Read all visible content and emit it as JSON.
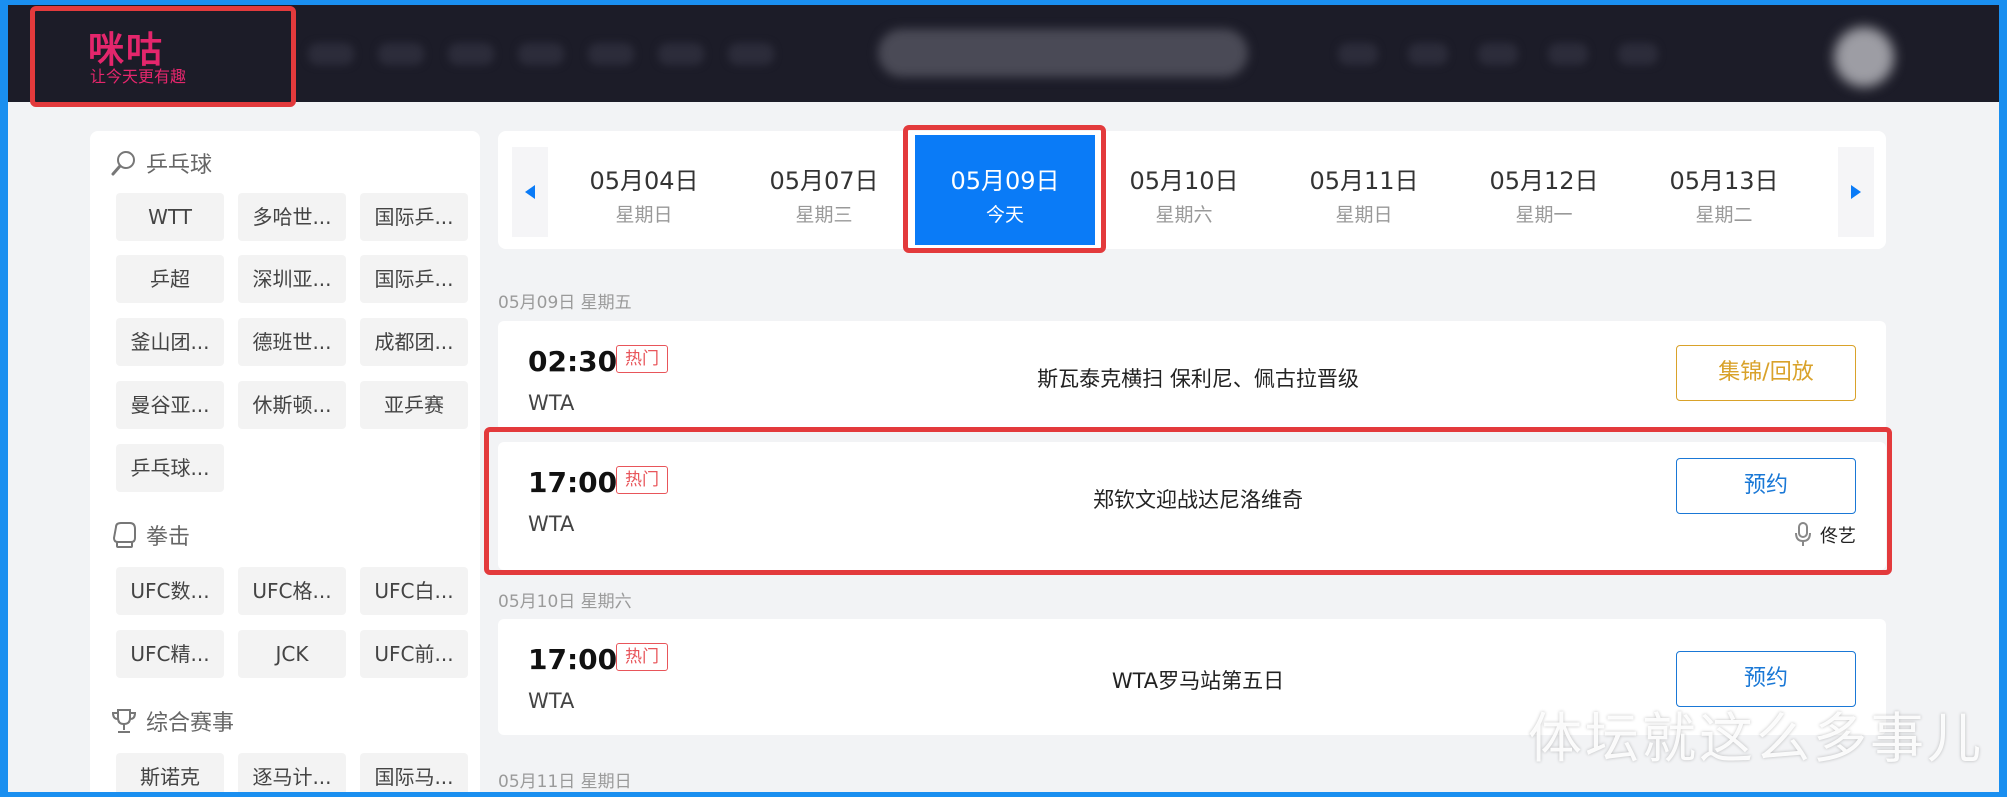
{
  "brand": {
    "name": "咪咕",
    "slogan": "让今天更有趣"
  },
  "sidebar": {
    "categories": [
      {
        "title": "乒乓球",
        "icon": "search-icon",
        "tags": [
          "WTT",
          "多哈世...",
          "国际乒...",
          "乒超",
          "深圳亚...",
          "国际乒...",
          "釜山团...",
          "德班世...",
          "成都团...",
          "曼谷亚...",
          "休斯顿...",
          "亚乒赛",
          "乒乓球..."
        ]
      },
      {
        "title": "拳击",
        "icon": "boxing-glove-icon",
        "tags": [
          "UFC数...",
          "UFC格...",
          "UFC白...",
          "UFC精...",
          "JCK",
          "UFC前..."
        ]
      },
      {
        "title": "综合赛事",
        "icon": "trophy-icon",
        "tags": [
          "斯诺克",
          "逐马计...",
          "国际马..."
        ]
      }
    ]
  },
  "dates": [
    {
      "date": "05月04日",
      "weekday": "星期日"
    },
    {
      "date": "05月07日",
      "weekday": "星期三"
    },
    {
      "date": "05月09日",
      "weekday": "今天",
      "active": true
    },
    {
      "date": "05月10日",
      "weekday": "星期六"
    },
    {
      "date": "05月11日",
      "weekday": "星期日"
    },
    {
      "date": "05月12日",
      "weekday": "星期一"
    },
    {
      "date": "05月13日",
      "weekday": "星期二"
    }
  ],
  "days": [
    {
      "label": "05月09日 星期五"
    },
    {
      "label": "05月10日 星期六"
    },
    {
      "label": "05月11日 星期日"
    }
  ],
  "matches": [
    {
      "time": "02:30",
      "badge": "热门",
      "league": "WTA",
      "title": "斯瓦泰克横扫 保利尼、佩古拉晋级",
      "button": "集锦/回放",
      "commentator": ""
    },
    {
      "time": "17:00",
      "badge": "热门",
      "league": "WTA",
      "title": "郑钦文迎战达尼洛维奇",
      "button": "预约",
      "commentator": "佟艺"
    },
    {
      "time": "17:00",
      "badge": "热门",
      "league": "WTA",
      "title": "WTA罗马站第五日",
      "button": "预约",
      "commentator": ""
    }
  ],
  "watermark": "体坛就这么多事儿",
  "colors": {
    "accent": "#0a7bf7",
    "highlight": "#e33a3c",
    "brand": "#e4266c",
    "hot": "#e8555a",
    "replay": "#d9a22a"
  }
}
